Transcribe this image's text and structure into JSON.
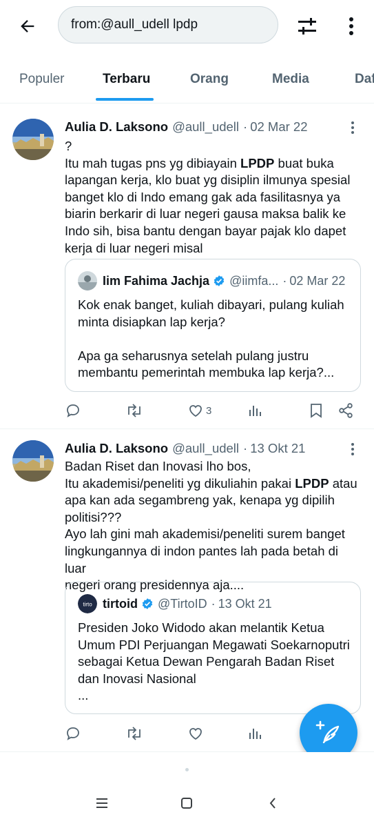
{
  "search": {
    "query": "from:@aull_udell lpdp"
  },
  "tabs": [
    {
      "label": "Populer"
    },
    {
      "label": "Terbaru"
    },
    {
      "label": "Orang"
    },
    {
      "label": "Media"
    },
    {
      "label": "Daftar"
    }
  ],
  "active_tab": "Terbaru",
  "tweets": [
    {
      "name": "Aulia D. Laksono",
      "handle": "@aull_udell",
      "sep": "·",
      "date": "02 Mar 22",
      "lines": [
        "?",
        "Itu mah tugas pns yg dibiayain ",
        "LPDP",
        " buat buka",
        "lapangan kerja, klo buat yg disiplin ilmunya spesial",
        "banget klo di Indo emang gak ada fasilitasnya ya",
        "biarin berkarir di luar negeri gausa maksa balik ke",
        "Indo sih, bisa bantu dengan bayar pajak klo dapet",
        "kerja di luar negeri misal"
      ],
      "quote": {
        "name": "Iim Fahima Jachja",
        "handle": "@iimfa...",
        "sep": "·",
        "date": "02 Mar 22",
        "lines": [
          "Kok enak banget, kuliah dibayari, pulang kuliah",
          "minta disiapkan lap kerja?",
          "",
          "Apa ga seharusnya setelah pulang justru",
          "membantu pemerintah membuka lap kerja?..."
        ]
      },
      "likes": "3"
    },
    {
      "name": "Aulia D. Laksono",
      "handle": "@aull_udell",
      "sep": "·",
      "date": "13 Okt 21",
      "lines": [
        "Badan Riset dan Inovasi lho bos,",
        "Itu akademisi/peneliti yg dikuliahin pakai ",
        "LPDP",
        " atau",
        "apa kan ada segambreng yak, kenapa yg dipilih",
        "politisi???",
        "Ayo lah gini mah akademisi/peneliti surem banget",
        "lingkungannya di indon pantes lah pada betah di luar",
        "negeri orang presidennya aja...."
      ],
      "quote": {
        "name": "tirtoid",
        "handle": "@TirtoID",
        "sep": "·",
        "date": "13 Okt 21",
        "avatar_text": "tirto",
        "lines": [
          "Presiden Joko Widodo akan melantik Ketua",
          "Umum PDI Perjuangan Megawati Soekarnoputri",
          "sebagai Ketua Dewan Pengarah Badan Riset",
          "dan Inovasi Nasional",
          "..."
        ]
      },
      "likes": ""
    }
  ],
  "colors": {
    "accent": "#1d9bf0",
    "text_primary": "#0f1419",
    "text_secondary": "#536471",
    "border": "#cfd9de"
  },
  "icons": [
    "back-arrow-icon",
    "filter-sliders-icon",
    "more-vertical-icon",
    "reply-icon",
    "retweet-icon",
    "like-icon",
    "views-icon",
    "bookmark-icon",
    "share-icon",
    "verified-icon",
    "compose-icon",
    "menu-icon",
    "home-square-icon",
    "back-chevron-icon"
  ]
}
